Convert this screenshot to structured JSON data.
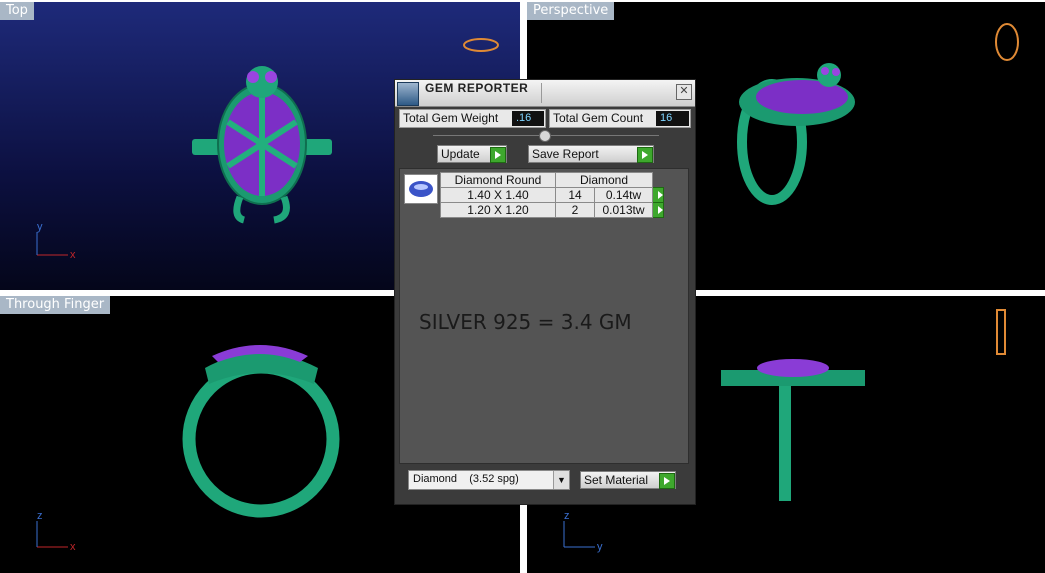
{
  "viewports": {
    "top": {
      "label": "Top"
    },
    "perspective": {
      "label": "Perspective"
    },
    "through_finger": {
      "label": "Through Finger"
    },
    "side": {
      "label": ""
    }
  },
  "axes": {
    "x": "x",
    "y": "y",
    "z": "z"
  },
  "dialog": {
    "title": "GEM REPORTER",
    "close_icon": "close-icon",
    "total_gem_weight_label": "Total Gem Weight",
    "total_gem_weight_value": ".16",
    "total_gem_count_label": "Total Gem Count",
    "total_gem_count_value": "16",
    "update_label": "Update",
    "save_report_label": "Save Report",
    "table": {
      "headers": [
        "Diamond Round",
        "Diamond"
      ],
      "rows": [
        {
          "size": "1.40 X 1.40",
          "count": "14",
          "weight": "0.14tw"
        },
        {
          "size": "1.20 X 1.20",
          "count": "2",
          "weight": "0.013tw"
        }
      ]
    },
    "note": "SILVER 925 = 3.4 GM",
    "material_select": "Diamond    (3.52 spg)",
    "set_material_label": "Set Material"
  },
  "colors": {
    "model": "#1fa77a",
    "gems": "#8a3cd6",
    "label_bg": "#a9b7c6",
    "play": "#3ea82d"
  }
}
